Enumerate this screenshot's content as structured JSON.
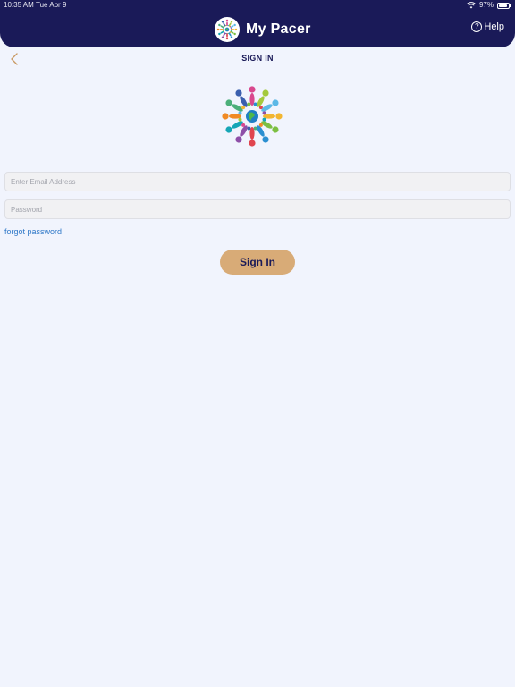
{
  "status_bar": {
    "time": "10:35 AM",
    "date": "Tue Apr 9",
    "battery": "97%",
    "icons": [
      "wifi-icon",
      "battery-icon"
    ]
  },
  "header": {
    "app_title": "My Pacer",
    "help_label": "Help",
    "help_icon": "question-circle-icon",
    "logo_icon": "pacer-logo-icon",
    "background_color": "#1a1a58"
  },
  "nav": {
    "back_icon": "chevron-left-icon",
    "page_title": "SIGN IN"
  },
  "form": {
    "email_placeholder": "Enter Email Address",
    "email_value": "",
    "password_placeholder": "Password",
    "password_value": "",
    "forgot_label": "forgot password",
    "submit_label": "Sign In"
  },
  "colors": {
    "accent": "#d8ab77",
    "link": "#2f78c8",
    "page_background": "#f1f4fd",
    "field_background": "#f1f1f3"
  }
}
